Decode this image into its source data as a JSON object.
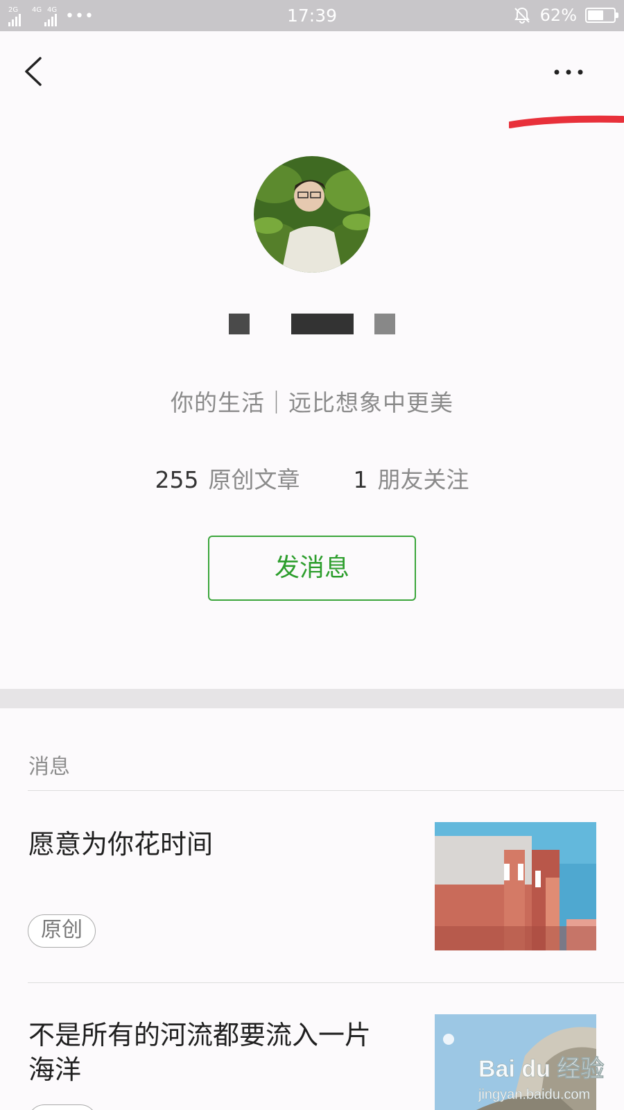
{
  "status_bar": {
    "sim1_label": "2G",
    "sim2_label": "4G",
    "sim2b_label": "4G",
    "more_indicator": "•••",
    "time": "17:39",
    "battery_percent": "62%",
    "battery_level": 0.62
  },
  "nav": {
    "back_icon": "chevron-left-icon",
    "more_icon": "ellipsis-icon"
  },
  "profile": {
    "bio": "你的生活｜远比想象中更美",
    "stats": [
      {
        "value": "255",
        "label": "原创文章"
      },
      {
        "value": "1",
        "label": "朋友关注"
      }
    ],
    "message_button": "发消息",
    "accent_color": "#2d9e2d"
  },
  "messages": {
    "section_title": "消息",
    "articles": [
      {
        "title": "愿意为你花时间",
        "badge": "原创"
      },
      {
        "title": "不是所有的河流都要流入一片海洋",
        "badge": ""
      }
    ]
  },
  "watermark": {
    "brand": "Bai du 经验",
    "url": "jingyan.baidu.com"
  },
  "colors": {
    "status_bar_bg": "#c8c6c9",
    "annotation_red": "#e8303a",
    "page_bg": "#fcfafc"
  }
}
